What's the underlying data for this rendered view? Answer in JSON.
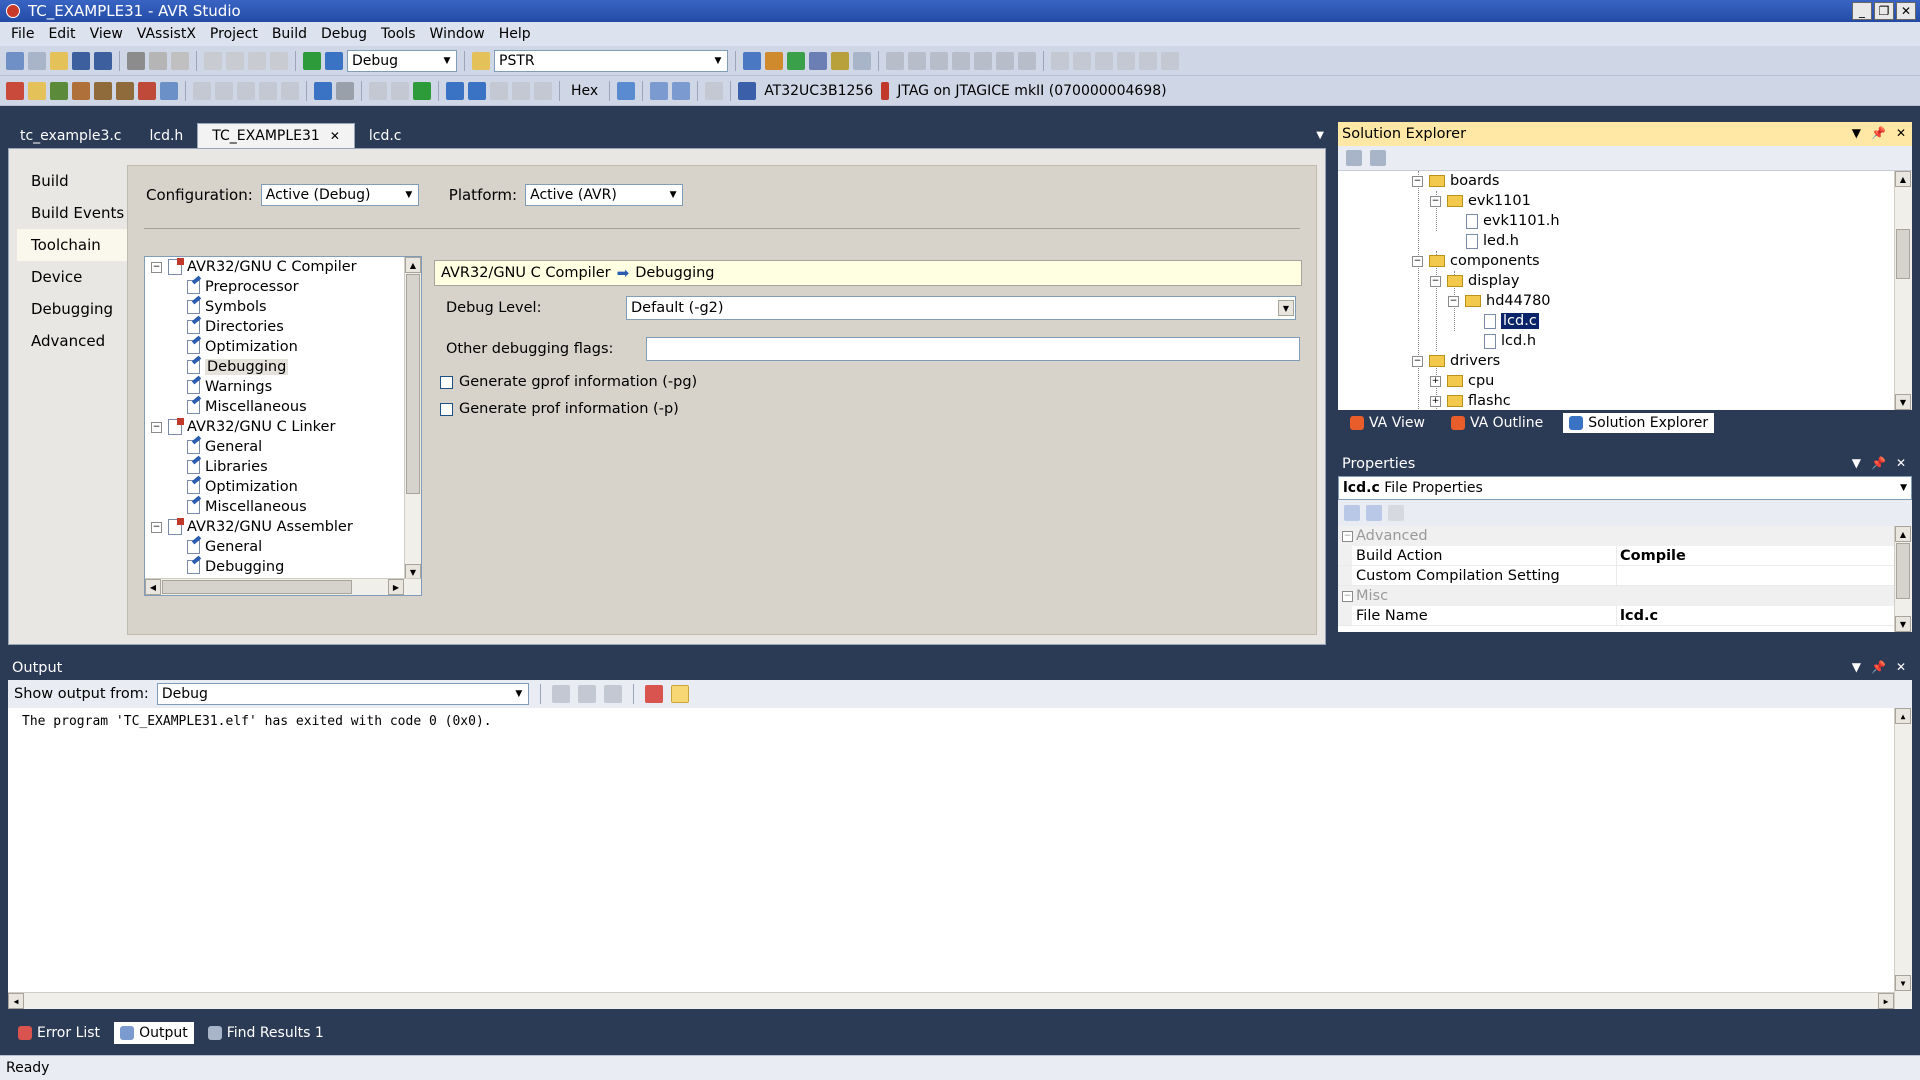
{
  "window": {
    "title": "TC_EXAMPLE31 - AVR Studio",
    "controls": [
      "_",
      "❐",
      "✕"
    ]
  },
  "menu": [
    "File",
    "Edit",
    "View",
    "VAssistX",
    "Project",
    "Build",
    "Debug",
    "Tools",
    "Window",
    "Help"
  ],
  "toolbar1": {
    "config_combo": "Debug",
    "find_combo": "PSTR"
  },
  "toolbar2": {
    "hex_label": "Hex",
    "device_label": "AT32UC3B1256",
    "tool_label": "JTAG on JTAGICE mkII (070000004698)"
  },
  "doc_tabs": [
    {
      "label": "tc_example3.c",
      "active": false
    },
    {
      "label": "lcd.h",
      "active": false
    },
    {
      "label": "TC_EXAMPLE31",
      "active": true
    },
    {
      "label": "lcd.c",
      "active": false
    }
  ],
  "doc_tab_close": "✕",
  "project_props": {
    "nav": [
      "Build",
      "Build Events",
      "Toolchain",
      "Device",
      "Debugging",
      "Advanced"
    ],
    "active_nav": "Toolchain",
    "configuration_label": "Configuration:",
    "configuration_value": "Active (Debug)",
    "platform_label": "Platform:",
    "platform_value": "Active (AVR)",
    "tree": [
      {
        "label": "AVR32/GNU C Compiler",
        "level": 0
      },
      {
        "label": "Preprocessor",
        "level": 1
      },
      {
        "label": "Symbols",
        "level": 1
      },
      {
        "label": "Directories",
        "level": 1
      },
      {
        "label": "Optimization",
        "level": 1
      },
      {
        "label": "Debugging",
        "level": 1,
        "selected": true
      },
      {
        "label": "Warnings",
        "level": 1
      },
      {
        "label": "Miscellaneous",
        "level": 1
      },
      {
        "label": "AVR32/GNU C Linker",
        "level": 0
      },
      {
        "label": "General",
        "level": 1
      },
      {
        "label": "Libraries",
        "level": 1
      },
      {
        "label": "Optimization",
        "level": 1
      },
      {
        "label": "Miscellaneous",
        "level": 1
      },
      {
        "label": "AVR32/GNU Assembler",
        "level": 0
      },
      {
        "label": "General",
        "level": 1
      },
      {
        "label": "Debugging",
        "level": 1
      }
    ],
    "header_left": "AVR32/GNU C Compiler",
    "header_right": "Debugging",
    "debug_level_label": "Debug Level:",
    "debug_level_value": "Default (-g2)",
    "other_flags_label": "Other debugging flags:",
    "other_flags_value": "",
    "gprof_label": "Generate gprof information (-pg)",
    "prof_label": "Generate prof information (-p)"
  },
  "solution_explorer": {
    "title": "Solution Explorer",
    "nodes": [
      {
        "label": "boards",
        "type": "folder",
        "expander": "−",
        "level": 0
      },
      {
        "label": "evk1101",
        "type": "folder",
        "expander": "−",
        "level": 1
      },
      {
        "label": "evk1101.h",
        "type": "file",
        "level": 2
      },
      {
        "label": "led.h",
        "type": "file",
        "level": 2
      },
      {
        "label": "components",
        "type": "folder",
        "expander": "−",
        "level": 0
      },
      {
        "label": "display",
        "type": "folder",
        "expander": "−",
        "level": 1
      },
      {
        "label": "hd44780",
        "type": "folder",
        "expander": "−",
        "level": 2
      },
      {
        "label": "lcd.c",
        "type": "file",
        "level": 3,
        "selected": true
      },
      {
        "label": "lcd.h",
        "type": "file",
        "level": 3
      },
      {
        "label": "drivers",
        "type": "folder",
        "expander": "−",
        "level": 0
      },
      {
        "label": "cpu",
        "type": "folder",
        "expander": "+",
        "level": 1
      },
      {
        "label": "flashc",
        "type": "folder",
        "expander": "+",
        "level": 1
      }
    ],
    "tabs": [
      {
        "label": "VA View",
        "active": false,
        "color": "#e85d2a"
      },
      {
        "label": "VA Outline",
        "active": false,
        "color": "#e85d2a"
      },
      {
        "label": "Solution Explorer",
        "active": true,
        "color": "#3b73c4"
      }
    ]
  },
  "properties": {
    "title": "Properties",
    "object": "lcd.c",
    "object_suffix": " File Properties",
    "categories": [
      {
        "name": "Advanced",
        "items": [
          {
            "name": "Build Action",
            "value": "Compile"
          },
          {
            "name": "Custom Compilation Setting",
            "value": ""
          }
        ]
      },
      {
        "name": "Misc",
        "items": [
          {
            "name": "File Name",
            "value": "lcd.c"
          }
        ]
      }
    ]
  },
  "output": {
    "title": "Output",
    "show_from_label": "Show output from:",
    "show_from_value": "Debug",
    "text": "The program 'TC_EXAMPLE31.elf' has exited with code 0 (0x0)."
  },
  "bottom_tabs": [
    {
      "label": "Error List",
      "active": false
    },
    {
      "label": "Output",
      "active": true
    },
    {
      "label": "Find Results 1",
      "active": false
    }
  ],
  "status": "Ready",
  "colors": {
    "chrome_dark": "#2b3a55",
    "panel_title_active": "#ffe8a6",
    "selection": "#0a246a"
  }
}
